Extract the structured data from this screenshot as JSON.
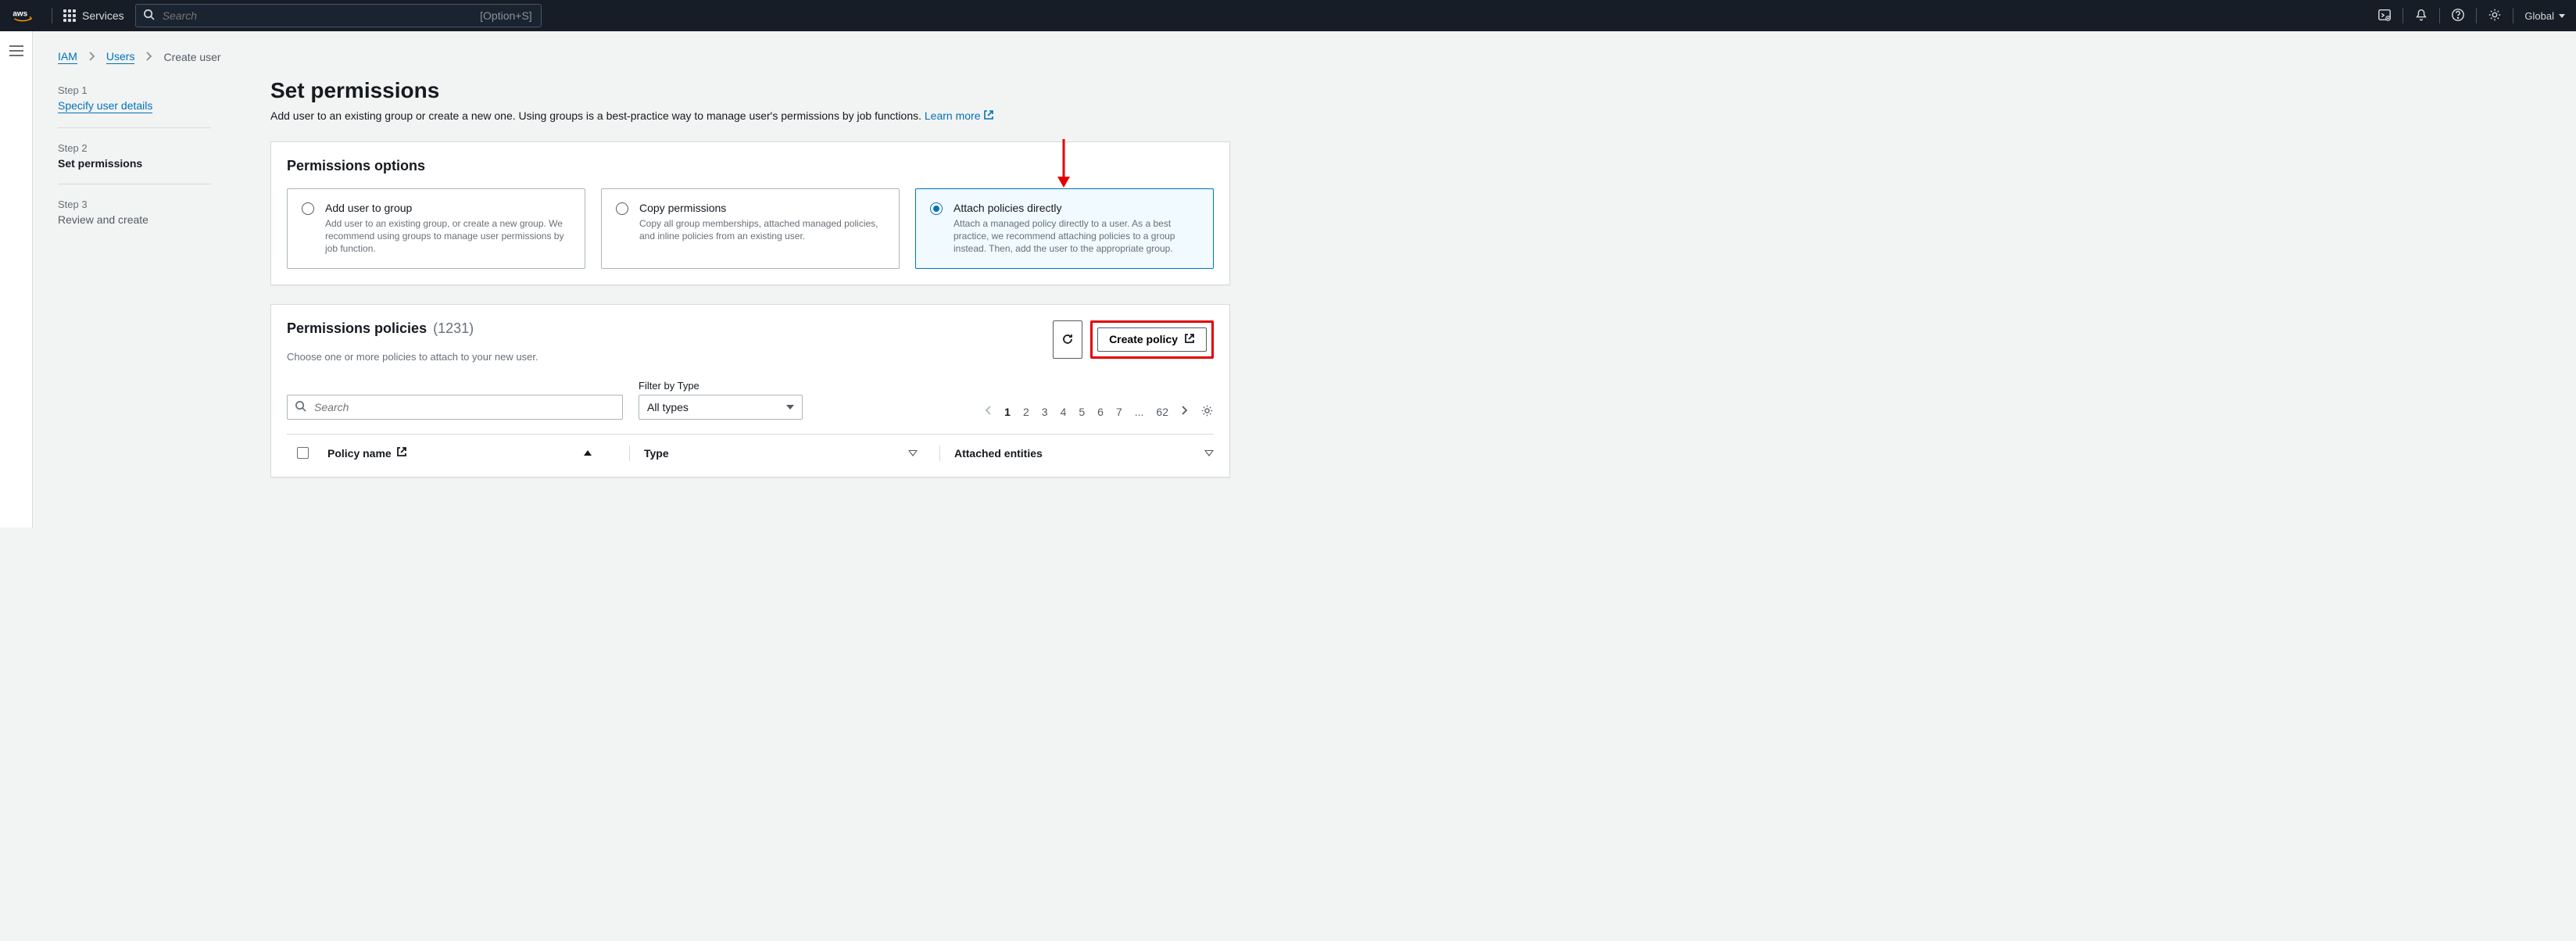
{
  "topnav": {
    "services_label": "Services",
    "search_placeholder": "Search",
    "search_shortcut": "[Option+S]",
    "region": "Global"
  },
  "breadcrumb": {
    "iam": "IAM",
    "users": "Users",
    "create_user": "Create user"
  },
  "steps": [
    {
      "label": "Step 1",
      "title": "Specify user details"
    },
    {
      "label": "Step 2",
      "title": "Set permissions"
    },
    {
      "label": "Step 3",
      "title": "Review and create"
    }
  ],
  "page": {
    "title": "Set permissions",
    "description": "Add user to an existing group or create a new one. Using groups is a best-practice way to manage user's permissions by job functions.",
    "learn_more": "Learn more"
  },
  "options_panel_title": "Permissions options",
  "options": [
    {
      "title": "Add user to group",
      "desc": "Add user to an existing group, or create a new group. We recommend using groups to manage user permissions by job function."
    },
    {
      "title": "Copy permissions",
      "desc": "Copy all group memberships, attached managed policies, and inline policies from an existing user."
    },
    {
      "title": "Attach policies directly",
      "desc": "Attach a managed policy directly to a user. As a best practice, we recommend attaching policies to a group instead. Then, add the user to the appropriate group."
    }
  ],
  "policies": {
    "title": "Permissions policies",
    "count": "(1231)",
    "subtitle": "Choose one or more policies to attach to your new user.",
    "create_label": "Create policy",
    "search_placeholder": "Search",
    "filter_label": "Filter by Type",
    "filter_value": "All types",
    "pagination": {
      "current": "1",
      "pages": [
        "1",
        "2",
        "3",
        "4",
        "5",
        "6",
        "7",
        "...",
        "62"
      ]
    },
    "columns": {
      "policy_name": "Policy name",
      "type": "Type",
      "attached": "Attached entities"
    }
  },
  "annotation": {
    "highlight_color": "#e30000"
  }
}
